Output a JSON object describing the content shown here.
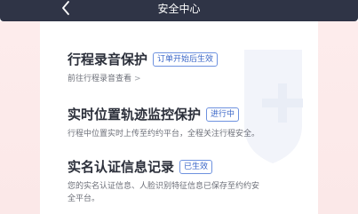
{
  "header": {
    "title": "安全中心"
  },
  "sections": [
    {
      "title": "行程录音保护",
      "badge": "订单开始后生效",
      "link_text": "前往行程录音查看",
      "link_chevron": ">"
    },
    {
      "title": "实时位置轨迹监控保护",
      "badge": "进行中",
      "desc": "行程中位置实时上传至约约平台，全程关注行程安全。"
    },
    {
      "title": "实名认证信息记录",
      "badge": "已生效",
      "desc_line1": "您的实名认证信息、人脸识别特征信息已保存至约约安",
      "desc_line2": "全平台。"
    }
  ],
  "colors": {
    "header_bg": "#2f3446",
    "side_bg": "#fdecec",
    "badge_accent": "#3a66c7",
    "title_text": "#2b2f3a",
    "desc_text": "#6c6f78"
  },
  "icons": {
    "back": "back-arrow-icon",
    "watermark": "shield-plus-watermark-icon"
  }
}
